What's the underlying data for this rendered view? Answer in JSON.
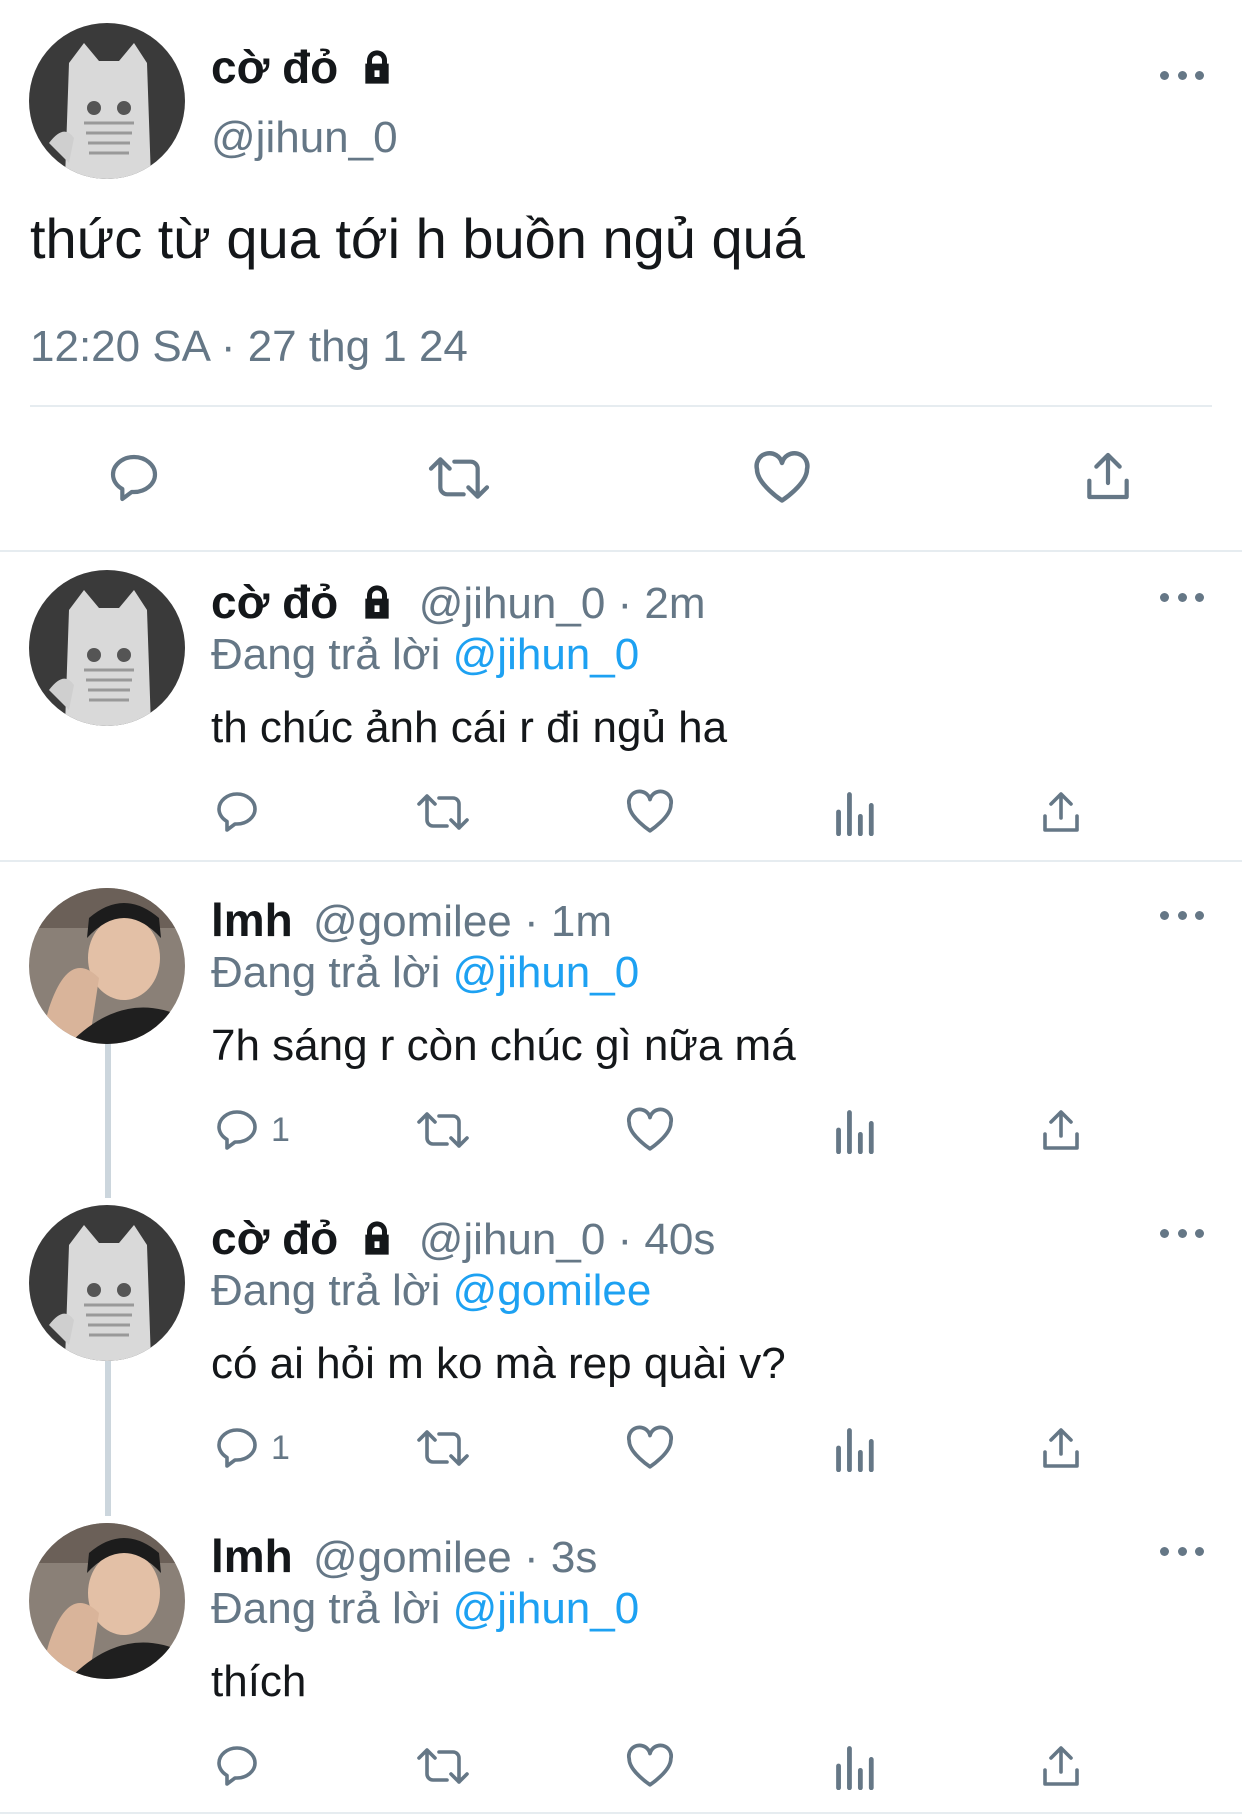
{
  "main_tweet": {
    "name": "cờ đỏ",
    "handle": "@jihun_0",
    "text": "thức từ qua tới h buồn ngủ quá",
    "timestamp": "12:20 SA · 27 thg 1 24"
  },
  "reply_prefix": "Đang trả lời",
  "replies": [
    {
      "name": "cờ đỏ",
      "meta": "@jihun_0 · 2m",
      "reply_to": "@jihun_0",
      "text": "th chúc ảnh cái r đi ngủ ha",
      "reply_count": ""
    },
    {
      "name": "lmh",
      "meta": "@gomilee · 1m",
      "reply_to": "@jihun_0",
      "text": "7h sáng r còn chúc gì nữa má",
      "reply_count": "1"
    },
    {
      "name": "cờ đỏ",
      "meta": "@jihun_0 · 40s",
      "reply_to": "@gomilee",
      "text": "có ai hỏi m ko mà rep quài v?",
      "reply_count": "1"
    },
    {
      "name": "lmh",
      "meta": "@gomilee · 3s",
      "reply_to": "@jihun_0",
      "text": "thích",
      "reply_count": ""
    }
  ],
  "colors": {
    "link": "#1da1f2",
    "secondary": "#657786",
    "divider": "#e6ecf0"
  },
  "icons": [
    "lock-icon",
    "more-icon",
    "reply-icon",
    "retweet-icon",
    "like-icon",
    "analytics-icon",
    "share-icon"
  ]
}
